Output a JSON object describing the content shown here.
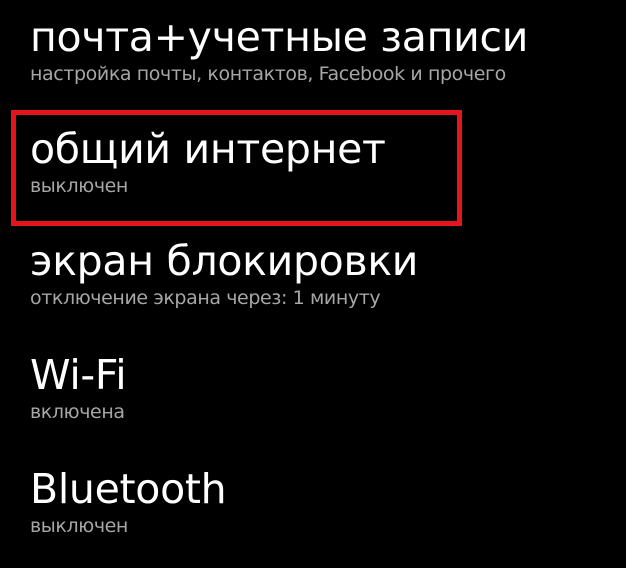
{
  "settings": {
    "items": [
      {
        "title": "почта+учетные записи",
        "subtitle": "настройка почты, контактов, Facebook и прочего"
      },
      {
        "title": "общий интернет",
        "subtitle": "выключен"
      },
      {
        "title": "экран блокировки",
        "subtitle": "отключение экрана через: 1 минуту"
      },
      {
        "title": "Wi-Fi",
        "subtitle": "включена"
      },
      {
        "title": "Bluetooth",
        "subtitle": "выключен"
      }
    ]
  },
  "colors": {
    "background": "#000000",
    "title_text": "#ffffff",
    "subtitle_text": "#a6a6a6",
    "highlight": "#e5151d"
  }
}
